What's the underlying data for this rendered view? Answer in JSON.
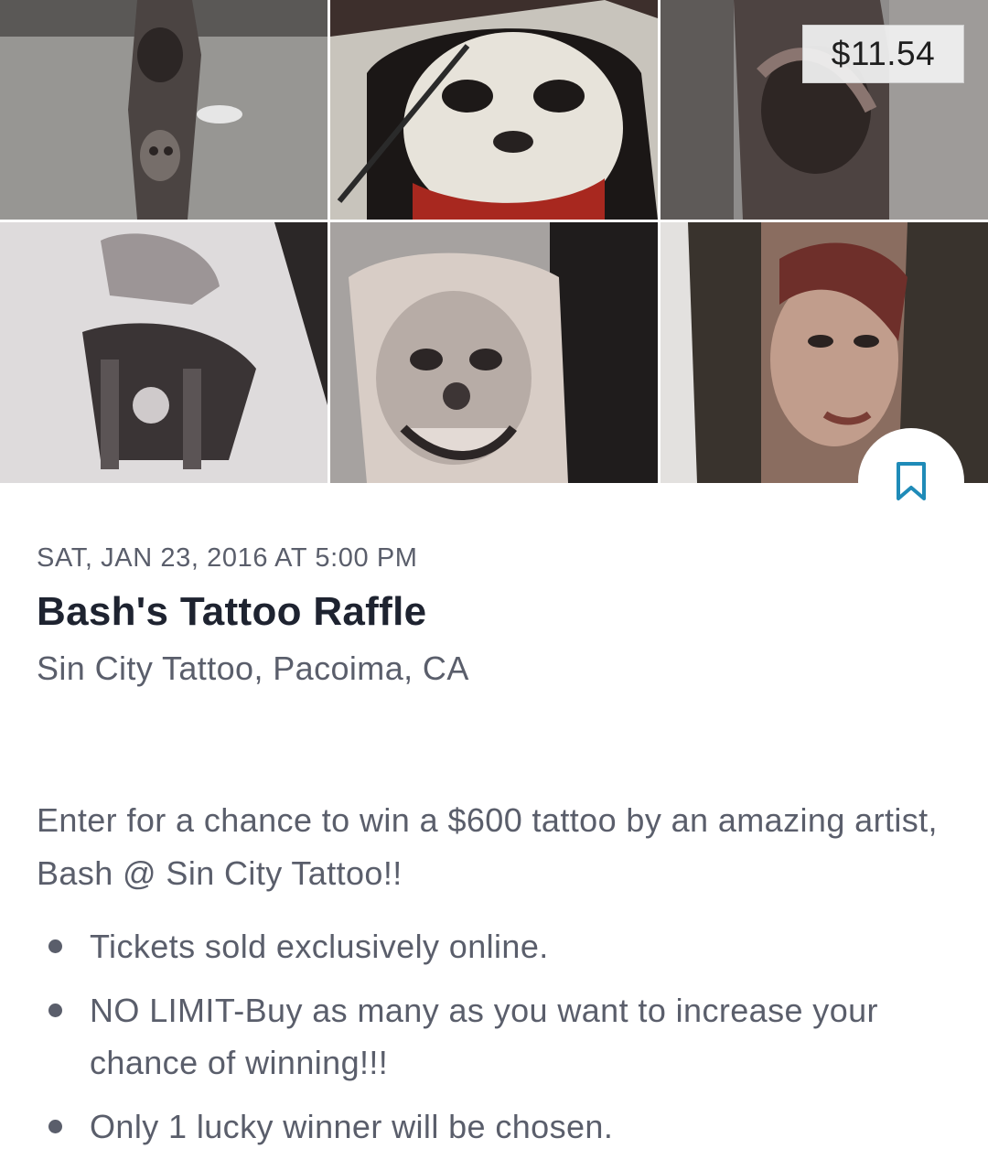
{
  "gallery": {
    "images": [
      {
        "name": "leg-sleeve-tattoo-photo"
      },
      {
        "name": "joker-drawing-photo"
      },
      {
        "name": "arm-tattoo-photo"
      },
      {
        "name": "puppeteer-hands-drawing-photo"
      },
      {
        "name": "clown-tattoo-photo"
      },
      {
        "name": "woman-portrait-tattoo-photo"
      }
    ],
    "price_badge": "$11.54"
  },
  "bookmark": {
    "icon": "bookmark-icon",
    "color": "#1f8bb8"
  },
  "event": {
    "date": "SAT, JAN 23, 2016 AT 5:00 PM",
    "title": "Bash's Tattoo Raffle",
    "venue": "Sin City Tattoo, Pacoima, CA"
  },
  "description": {
    "intro": "Enter for a chance to win a $600 tattoo by an amazing artist, Bash @ Sin City Tattoo!!",
    "bullets": [
      "Tickets sold exclusively online.",
      "NO LIMIT-Buy as many as you want to increase your chance of winning!!!",
      "Only 1 lucky winner will be chosen."
    ]
  }
}
